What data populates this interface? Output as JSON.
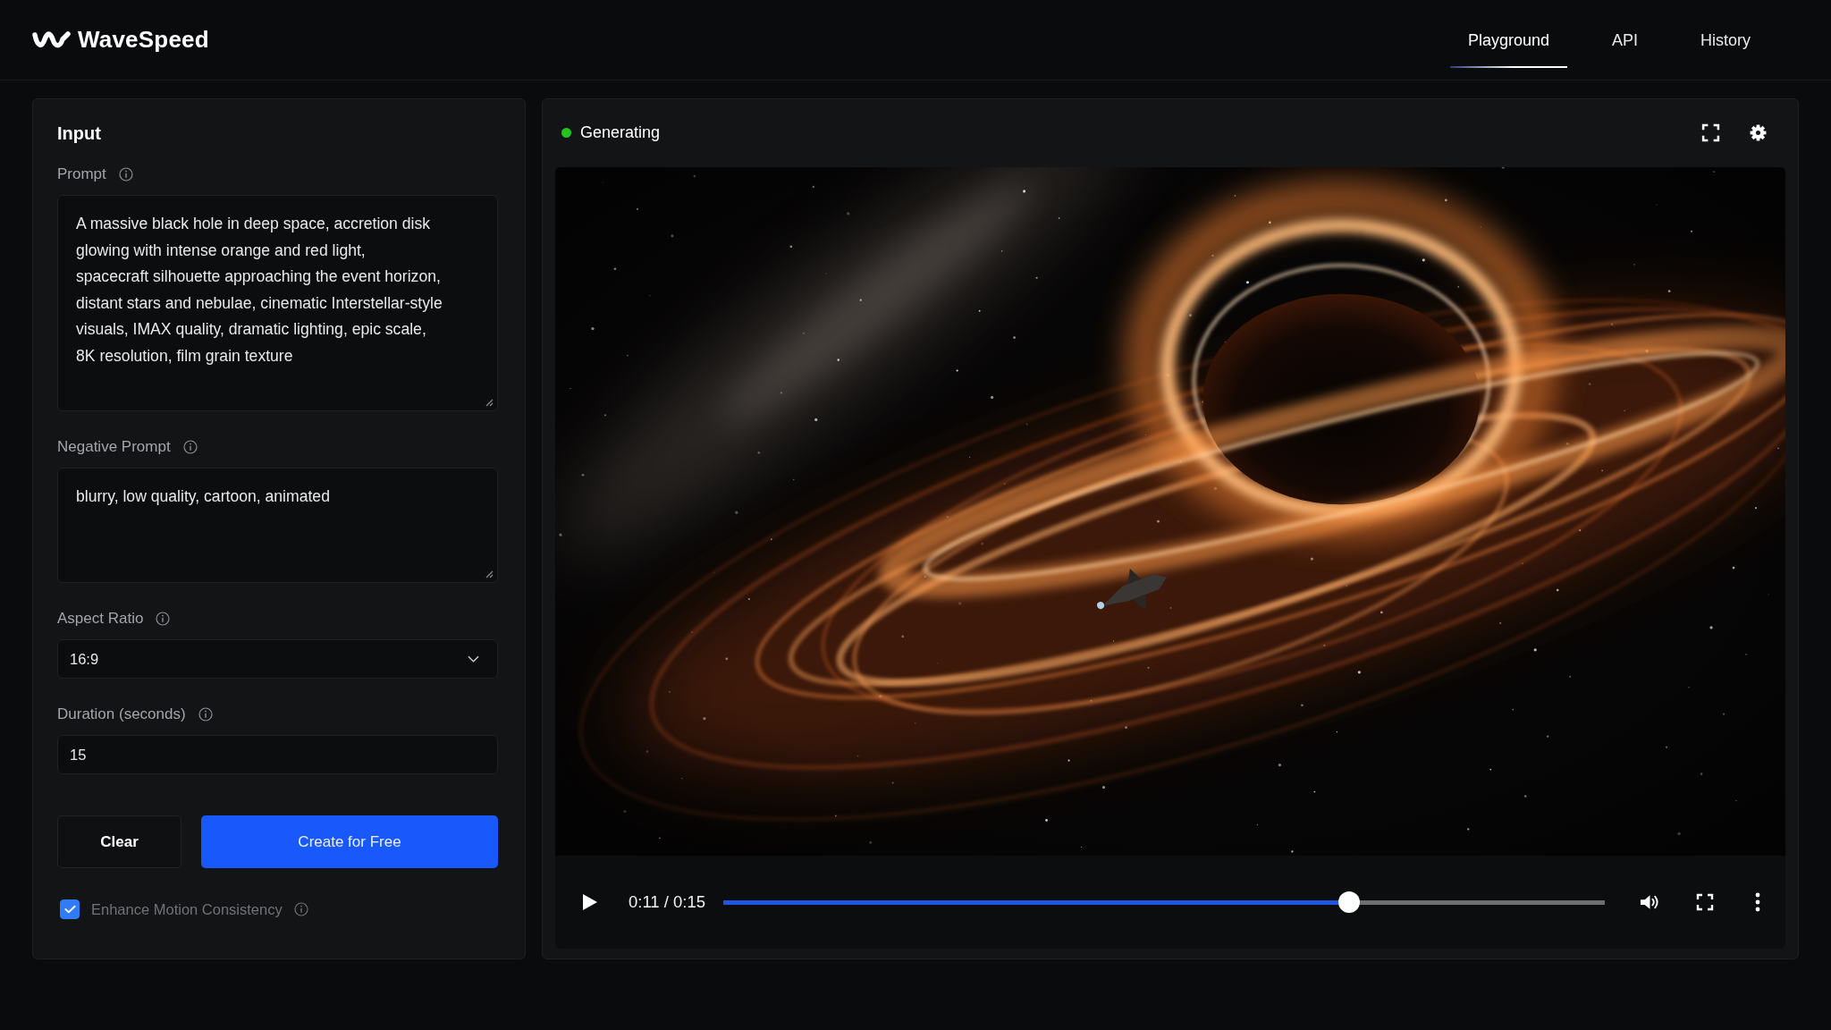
{
  "header": {
    "brand": "WaveSpeed",
    "tabs": [
      {
        "label": "Playground",
        "selected": true
      },
      {
        "label": "API",
        "selected": false
      },
      {
        "label": "History",
        "selected": false
      }
    ]
  },
  "input_panel": {
    "title": "Input",
    "fields": [
      {
        "kind": "textarea",
        "label": "Prompt",
        "value": "A massive black hole in deep space, accretion disk\nglowing with intense orange and red light,\nspacecraft silhouette approaching the event horizon,\ndistant stars and nebulae, cinematic Interstellar-style\nvisuals, IMAX quality, dramatic lighting, epic scale,\n8K resolution, film grain texture"
      },
      {
        "kind": "textarea",
        "label": "Negative Prompt",
        "value": "blurry, low quality, cartoon, animated"
      },
      {
        "kind": "select",
        "label": "Aspect Ratio",
        "value": "16:9"
      },
      {
        "kind": "number",
        "label": "Duration (seconds)",
        "value": "15"
      }
    ],
    "buttons": [
      {
        "kind": "secondary",
        "label": "Clear"
      },
      {
        "kind": "primary",
        "label": "Create for Free"
      }
    ],
    "options": [
      {
        "label": "Enhance Motion Consistency",
        "checked": true
      }
    ]
  },
  "output_panel": {
    "status": {
      "label": "Generating",
      "live": true
    },
    "player": {
      "time": "0:11 / 0:15",
      "progress": {
        "level": 0.71
      }
    }
  }
}
